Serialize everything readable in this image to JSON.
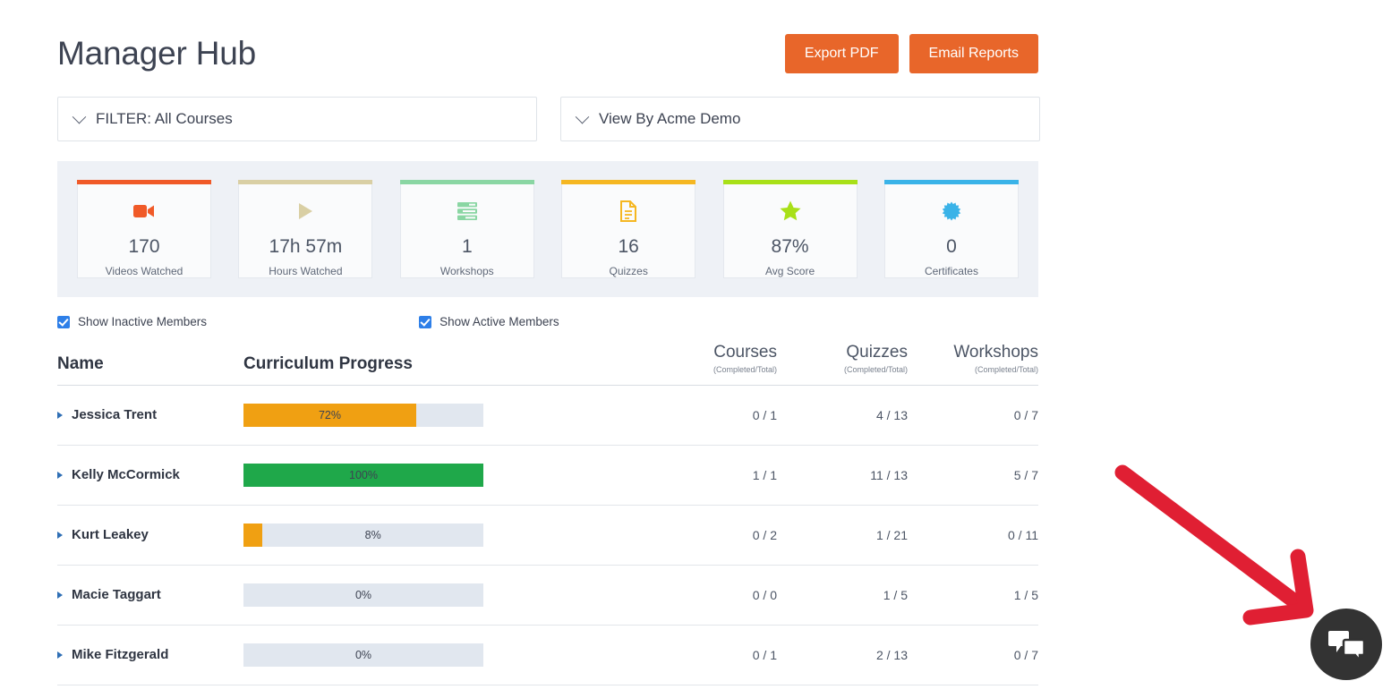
{
  "header": {
    "title": "Manager Hub",
    "buttons": [
      {
        "label": "Export PDF",
        "name": "export-pdf-button"
      },
      {
        "label": "Email Reports",
        "name": "email-reports-button"
      }
    ],
    "accent_color": "#e8662a"
  },
  "filters": [
    {
      "label": "FILTER: All Courses",
      "name": "filter-courses-select"
    },
    {
      "label": "View By Acme Demo",
      "name": "view-by-select"
    }
  ],
  "stats": [
    {
      "value": "170",
      "label": "Videos Watched",
      "color": "#f05a28",
      "icon": "video-camera-icon"
    },
    {
      "value": "17h 57m",
      "label": "Hours Watched",
      "color": "#d9cfa4",
      "icon": "play-icon"
    },
    {
      "value": "1",
      "label": "Workshops",
      "color": "#8ad6a3",
      "icon": "stack-icon"
    },
    {
      "value": "16",
      "label": "Quizzes",
      "color": "#f5b722",
      "icon": "document-icon"
    },
    {
      "value": "87%",
      "label": "Avg Score",
      "color": "#a8e018",
      "icon": "star-icon"
    },
    {
      "value": "0",
      "label": "Certificates",
      "color": "#3ab3e8",
      "icon": "certificate-icon"
    }
  ],
  "checkboxes": [
    {
      "label": "Show Inactive Members",
      "checked": true
    },
    {
      "label": "Show Active Members",
      "checked": true
    }
  ],
  "table": {
    "headers": {
      "name": "Name",
      "progress": "Curriculum Progress",
      "courses": "Courses",
      "quizzes": "Quizzes",
      "workshops": "Workshops",
      "sub": "(Completed/Total)"
    },
    "rows": [
      {
        "name": "Jessica Trent",
        "percent": 72,
        "percent_label": "72%",
        "bar_color": "#f0a012",
        "courses": "0 / 1",
        "quizzes": "4 / 13",
        "workshops": "0 / 7"
      },
      {
        "name": "Kelly McCormick",
        "percent": 100,
        "percent_label": "100%",
        "bar_color": "#1fa84a",
        "courses": "1 / 1",
        "quizzes": "11 / 13",
        "workshops": "5 / 7"
      },
      {
        "name": "Kurt Leakey",
        "percent": 8,
        "percent_label": "8%",
        "bar_color": "#f0a012",
        "courses": "0 / 2",
        "quizzes": "1 / 21",
        "workshops": "0 / 11"
      },
      {
        "name": "Macie Taggart",
        "percent": 0,
        "percent_label": "0%",
        "bar_color": "#f0a012",
        "courses": "0 / 0",
        "quizzes": "1 / 5",
        "workshops": "1 / 5"
      },
      {
        "name": "Mike Fitzgerald",
        "percent": 0,
        "percent_label": "0%",
        "bar_color": "#f0a012",
        "courses": "0 / 1",
        "quizzes": "2 / 13",
        "workshops": "0 / 7"
      }
    ]
  },
  "annotation": {
    "arrow_color": "#e01f33",
    "points_to": "chat-widget-button"
  },
  "chat_widget": {
    "icon": "chat-bubbles-icon",
    "color": "#333333"
  }
}
